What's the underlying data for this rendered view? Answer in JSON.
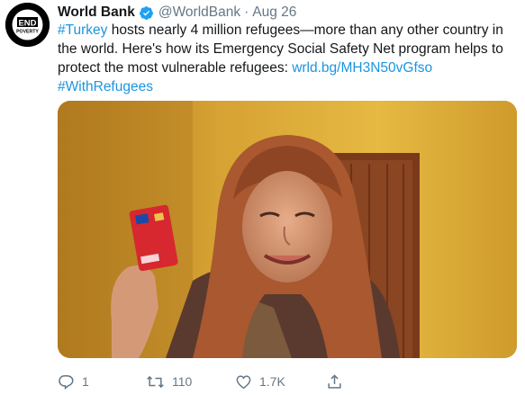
{
  "account": {
    "display_name": "World Bank",
    "handle": "@WorldBank",
    "separator": "·",
    "date": "Aug 26",
    "avatar_text_top": "END",
    "avatar_text_bottom": "POVERTY"
  },
  "tweet": {
    "line1": {
      "hashtag": "#Turkey",
      "text": " hosts nearly 4 million refugees—more than any other country in"
    },
    "line2": "the world. Here's how its Emergency Social Safety Net program helps to",
    "line3": {
      "text": "protect the most vulnerable refugees: ",
      "link": "wrld.bg/MH3N50vGfso"
    },
    "line4": {
      "hashtag": "#WithRefugees"
    }
  },
  "actions": {
    "reply_count": "1",
    "retweet_count": "110",
    "like_count": "1.7K"
  },
  "colors": {
    "link": "#1b95e0",
    "verified": "#1da1f2",
    "muted": "#657786"
  },
  "icons": [
    "verified-badge-icon",
    "reply-icon",
    "retweet-icon",
    "like-icon",
    "share-icon"
  ]
}
